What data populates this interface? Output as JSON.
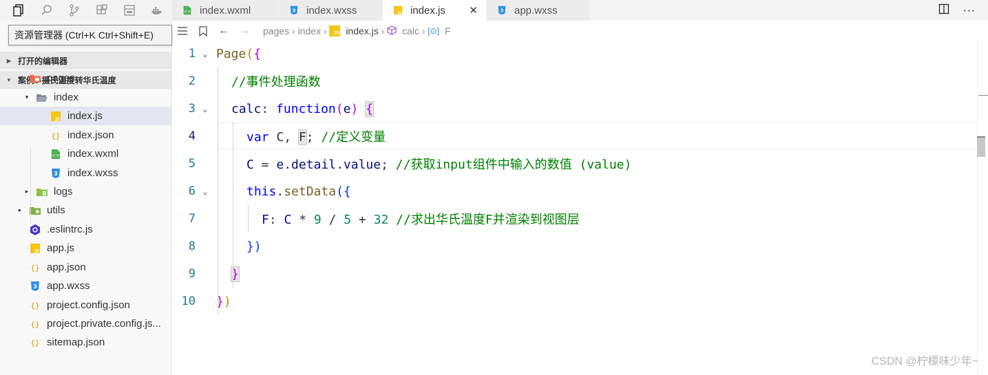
{
  "activity_bar": {
    "icons": [
      "files-icon",
      "search-icon",
      "source-control-icon",
      "extensions-icon",
      "debug-icon",
      "docker-icon"
    ]
  },
  "tooltip": {
    "text": "资源管理器 (Ctrl+K Ctrl+Shift+E)"
  },
  "sidebar": {
    "open_editors_label": "打开的编辑器",
    "project_label": "案例9-摄氏温度转华氏温度",
    "tree": [
      {
        "label": "pages",
        "depth": 1,
        "twisty": "▾",
        "icon": "folder-pages-icon",
        "selected": false
      },
      {
        "label": "index",
        "depth": 2,
        "twisty": "▾",
        "icon": "folder-open-icon",
        "selected": false
      },
      {
        "label": "index.js",
        "depth": 3,
        "twisty": "",
        "icon": "js-file-icon",
        "selected": true
      },
      {
        "label": "index.json",
        "depth": 3,
        "twisty": "",
        "icon": "json-file-icon",
        "selected": false
      },
      {
        "label": "index.wxml",
        "depth": 3,
        "twisty": "",
        "icon": "wxml-file-icon",
        "selected": false
      },
      {
        "label": "index.wxss",
        "depth": 3,
        "twisty": "",
        "icon": "wxss-file-icon",
        "selected": false
      },
      {
        "label": "logs",
        "depth": 2,
        "twisty": "▸",
        "icon": "folder-logs-icon",
        "selected": false
      },
      {
        "label": "utils",
        "depth": 1,
        "twisty": "▸",
        "icon": "folder-utils-icon",
        "selected": false
      },
      {
        "label": ".eslintrc.js",
        "depth": 1,
        "twisty": "",
        "icon": "eslint-file-icon",
        "selected": false
      },
      {
        "label": "app.js",
        "depth": 1,
        "twisty": "",
        "icon": "js-file-icon",
        "selected": false
      },
      {
        "label": "app.json",
        "depth": 1,
        "twisty": "",
        "icon": "json-file-icon",
        "selected": false
      },
      {
        "label": "app.wxss",
        "depth": 1,
        "twisty": "",
        "icon": "wxss-file-icon",
        "selected": false
      },
      {
        "label": "project.config.json",
        "depth": 1,
        "twisty": "",
        "icon": "json-file-icon",
        "selected": false
      },
      {
        "label": "project.private.config.js...",
        "depth": 1,
        "twisty": "",
        "icon": "json-file-icon",
        "selected": false
      },
      {
        "label": "sitemap.json",
        "depth": 1,
        "twisty": "",
        "icon": "json-file-icon",
        "selected": false
      }
    ]
  },
  "tabs": [
    {
      "label": "index.wxml",
      "icon": "wxml-file-icon",
      "active": false
    },
    {
      "label": "index.wxss",
      "icon": "wxss-file-icon",
      "active": false
    },
    {
      "label": "index.js",
      "icon": "js-file-icon",
      "active": true,
      "close": "✕"
    },
    {
      "label": "app.wxss",
      "icon": "wxss-file-icon",
      "active": false
    }
  ],
  "breadcrumb": {
    "items": [
      "pages",
      "index",
      "index.js",
      "calc",
      "F"
    ],
    "separator": "›"
  },
  "editor": {
    "current_line": 4,
    "lines": [
      {
        "no": "1",
        "fold": true,
        "tokens": [
          [
            "Page",
            "tk-fn"
          ],
          [
            "(",
            "tk-gold"
          ],
          [
            "{",
            "tk-purple"
          ]
        ]
      },
      {
        "no": "2",
        "fold": false,
        "tokens": [
          [
            "//事件处理函数",
            "tk-com"
          ]
        ]
      },
      {
        "no": "3",
        "fold": true,
        "tokens": [
          [
            "calc",
            "tk-var"
          ],
          [
            ": ",
            "tk-plain"
          ],
          [
            "function",
            "tk-kw"
          ],
          [
            "(",
            "tk-purple"
          ],
          [
            "e",
            "tk-var"
          ],
          [
            ") ",
            "tk-purple"
          ],
          [
            "{",
            "tk-purple hl-box"
          ]
        ]
      },
      {
        "no": "4",
        "fold": false,
        "tokens": [
          [
            "var",
            "tk-kw"
          ],
          [
            " C, ",
            "tk-plain"
          ],
          [
            "F",
            "tk-plain hl-box"
          ],
          [
            "; ",
            "tk-plain"
          ],
          [
            "//定义变量",
            "tk-com"
          ]
        ]
      },
      {
        "no": "5",
        "fold": false,
        "tokens": [
          [
            "C",
            "tk-var"
          ],
          [
            " = ",
            "tk-plain"
          ],
          [
            "e",
            "tk-var"
          ],
          [
            ".",
            "tk-plain"
          ],
          [
            "detail",
            "tk-var"
          ],
          [
            ".",
            "tk-plain"
          ],
          [
            "value",
            "tk-var"
          ],
          [
            "; ",
            "tk-plain"
          ],
          [
            "//获取input组件中输入的数值 (value)",
            "tk-com"
          ]
        ]
      },
      {
        "no": "6",
        "fold": true,
        "tokens": [
          [
            "this",
            "tk-kw"
          ],
          [
            ".",
            "tk-plain"
          ],
          [
            "setData",
            "tk-fn"
          ],
          [
            "(",
            "tk-br1"
          ],
          [
            "{",
            "tk-br1"
          ]
        ]
      },
      {
        "no": "7",
        "fold": false,
        "tokens": [
          [
            "F",
            "tk-var"
          ],
          [
            ": ",
            "tk-plain"
          ],
          [
            "C",
            "tk-var"
          ],
          [
            " * ",
            "tk-plain"
          ],
          [
            "9",
            "tk-num"
          ],
          [
            " / ",
            "tk-plain"
          ],
          [
            "5",
            "tk-num"
          ],
          [
            " + ",
            "tk-plain"
          ],
          [
            "32",
            "tk-num"
          ],
          [
            " ",
            "tk-plain"
          ],
          [
            "//求出华氏温度F并渲染到视图层",
            "tk-com"
          ]
        ]
      },
      {
        "no": "8",
        "fold": false,
        "tokens": [
          [
            "}",
            "tk-br1"
          ],
          [
            ")",
            "tk-br1"
          ]
        ]
      },
      {
        "no": "9",
        "fold": false,
        "tokens": [
          [
            "}",
            "tk-purple hl-box"
          ]
        ]
      },
      {
        "no": "10",
        "fold": false,
        "tokens": [
          [
            "}",
            "tk-purple"
          ],
          [
            ")",
            "tk-gold"
          ]
        ]
      }
    ]
  },
  "watermark": "CSDN @柠檬味少年~"
}
